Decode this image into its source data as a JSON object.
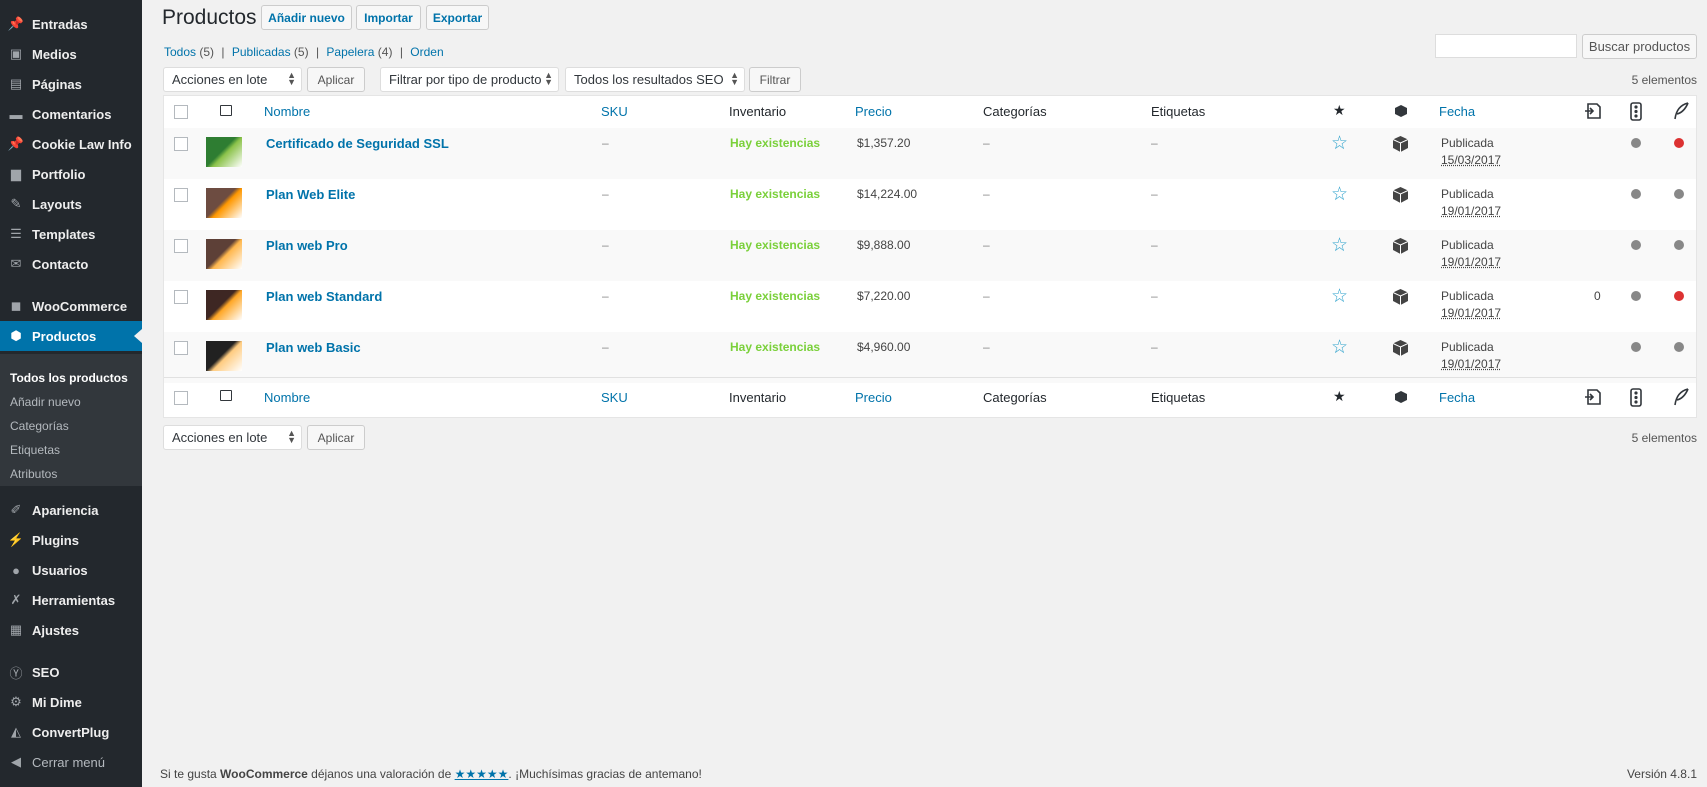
{
  "sidebar": {
    "items": [
      {
        "label": "Entradas",
        "icon": "pin-icon"
      },
      {
        "label": "Medios",
        "icon": "media-icon"
      },
      {
        "label": "Páginas",
        "icon": "pages-icon"
      },
      {
        "label": "Comentarios",
        "icon": "comment-icon"
      },
      {
        "label": "Cookie Law Info",
        "icon": "pin-icon"
      },
      {
        "label": "Portfolio",
        "icon": "folder-icon"
      },
      {
        "label": "Layouts",
        "icon": "pencil-icon"
      },
      {
        "label": "Templates",
        "icon": "list-icon"
      },
      {
        "label": "Contacto",
        "icon": "mail-icon"
      },
      {
        "label": "WooCommerce",
        "icon": "woo-icon"
      },
      {
        "label": "Productos",
        "icon": "box-icon"
      },
      {
        "label": "Apariencia",
        "icon": "brush-icon"
      },
      {
        "label": "Plugins",
        "icon": "plug-icon"
      },
      {
        "label": "Usuarios",
        "icon": "user-icon"
      },
      {
        "label": "Herramientas",
        "icon": "wrench-icon"
      },
      {
        "label": "Ajustes",
        "icon": "sliders-icon"
      },
      {
        "label": "SEO",
        "icon": "seo-icon"
      },
      {
        "label": "Mi Dime",
        "icon": "gear-icon"
      },
      {
        "label": "ConvertPlug",
        "icon": "plug-logo-icon"
      },
      {
        "label": "Cerrar menú",
        "icon": "collapse-icon"
      }
    ],
    "submenu": [
      "Todos los productos",
      "Añadir nuevo",
      "Categorías",
      "Etiquetas",
      "Atributos"
    ]
  },
  "header": {
    "title": "Productos",
    "add_new": "Añadir nuevo",
    "import": "Importar",
    "export": "Exportar"
  },
  "views": {
    "all": "Todos",
    "all_count": "(5)",
    "published": "Publicadas",
    "published_count": "(5)",
    "trash": "Papelera",
    "trash_count": "(4)",
    "order": "Orden",
    "separator": "|"
  },
  "search": {
    "value": "",
    "button": "Buscar productos"
  },
  "toolbar": {
    "bulk_actions": "Acciones en lote",
    "apply": "Aplicar",
    "filter_type": "Filtrar por tipo de producto",
    "seo_filter": "Todos los resultados SEO",
    "filter": "Filtrar",
    "item_count": "5 elementos"
  },
  "columns": {
    "name": "Nombre",
    "sku": "SKU",
    "stock": "Inventario",
    "price": "Precio",
    "categories": "Categorías",
    "tags": "Etiquetas",
    "date": "Fecha"
  },
  "rows": [
    {
      "name": "Certificado de Seguridad SSL",
      "sku": "–",
      "stock": "Hay existencias",
      "price": "$1,357.20",
      "categories": "–",
      "tags": "–",
      "status": "Publicada",
      "date": "15/03/2017",
      "links": "",
      "readability_color": "#888888",
      "seo_color": "#dc3232"
    },
    {
      "name": "Plan Web Elite",
      "sku": "–",
      "stock": "Hay existencias",
      "price": "$14,224.00",
      "categories": "–",
      "tags": "–",
      "status": "Publicada",
      "date": "19/01/2017",
      "links": "",
      "readability_color": "#888888",
      "seo_color": "#888888"
    },
    {
      "name": "Plan web Pro",
      "sku": "–",
      "stock": "Hay existencias",
      "price": "$9,888.00",
      "categories": "–",
      "tags": "–",
      "status": "Publicada",
      "date": "19/01/2017",
      "links": "",
      "readability_color": "#888888",
      "seo_color": "#888888"
    },
    {
      "name": "Plan web Standard",
      "sku": "–",
      "stock": "Hay existencias",
      "price": "$7,220.00",
      "categories": "–",
      "tags": "–",
      "status": "Publicada",
      "date": "19/01/2017",
      "links": "0",
      "readability_color": "#888888",
      "seo_color": "#dc3232"
    },
    {
      "name": "Plan web Basic",
      "sku": "–",
      "stock": "Hay existencias",
      "price": "$4,960.00",
      "categories": "–",
      "tags": "–",
      "status": "Publicada",
      "date": "19/01/2017",
      "links": "",
      "readability_color": "#888888",
      "seo_color": "#888888"
    }
  ],
  "footer": {
    "prefix": "Si te gusta ",
    "brand": "WooCommerce",
    "middle": " déjanos una valoración de ",
    "stars": "★★★★★",
    "suffix": ". ¡Muchísimas gracias de antemano!",
    "version": "Versión 4.8.1"
  },
  "colors": {
    "sidebar_bg": "#23282d",
    "accent": "#0073aa",
    "in_stock": "#7ad03a",
    "star": "#2ea2cc"
  }
}
